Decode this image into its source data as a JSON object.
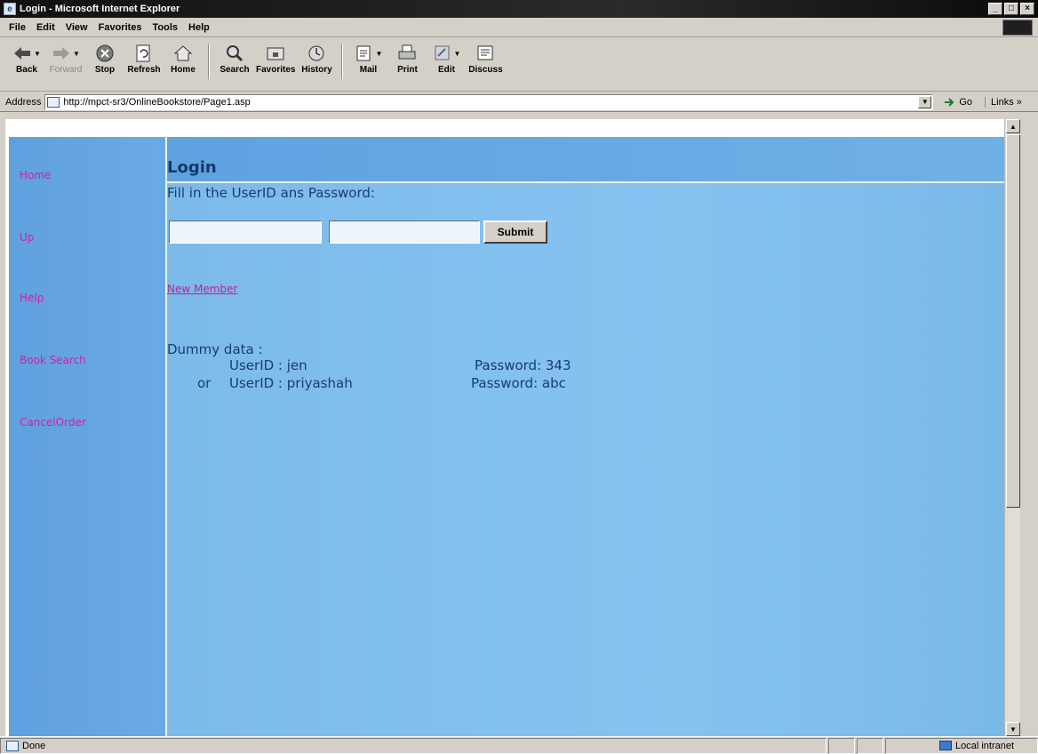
{
  "window": {
    "title": "Login - Microsoft Internet Explorer",
    "controls": [
      "_",
      "□",
      "×"
    ]
  },
  "menu": [
    "File",
    "Edit",
    "View",
    "Favorites",
    "Tools",
    "Help"
  ],
  "toolbar": {
    "back": "Back",
    "forward": "Forward",
    "stop": "Stop",
    "refresh": "Refresh",
    "home": "Home",
    "search": "Search",
    "favorites": "Favorites",
    "history": "History",
    "mail": "Mail",
    "print": "Print",
    "edit": "Edit",
    "discuss": "Discuss"
  },
  "address": {
    "label": "Address",
    "url": "http://mpct-sr3/OnlineBookstore/Page1.asp",
    "go": "Go",
    "links": "Links »"
  },
  "sidebar": {
    "items": [
      "Home",
      "Up",
      "Help",
      "Book Search",
      "CancelOrder"
    ]
  },
  "page": {
    "title": "Login",
    "instruction": "Fill in the UserID ans Password:",
    "userid_value": "",
    "password_value": "",
    "submit": "Submit",
    "new_member": "New Member",
    "dummy_title": "Dummy data :",
    "row1_userid": "UserID : jen",
    "row1_password": "Password: 343",
    "or": "or",
    "row2_userid": "UserID :  priyashah",
    "row2_password": "Password: abc"
  },
  "status": {
    "text": "Done",
    "zone": "Local intranet"
  }
}
